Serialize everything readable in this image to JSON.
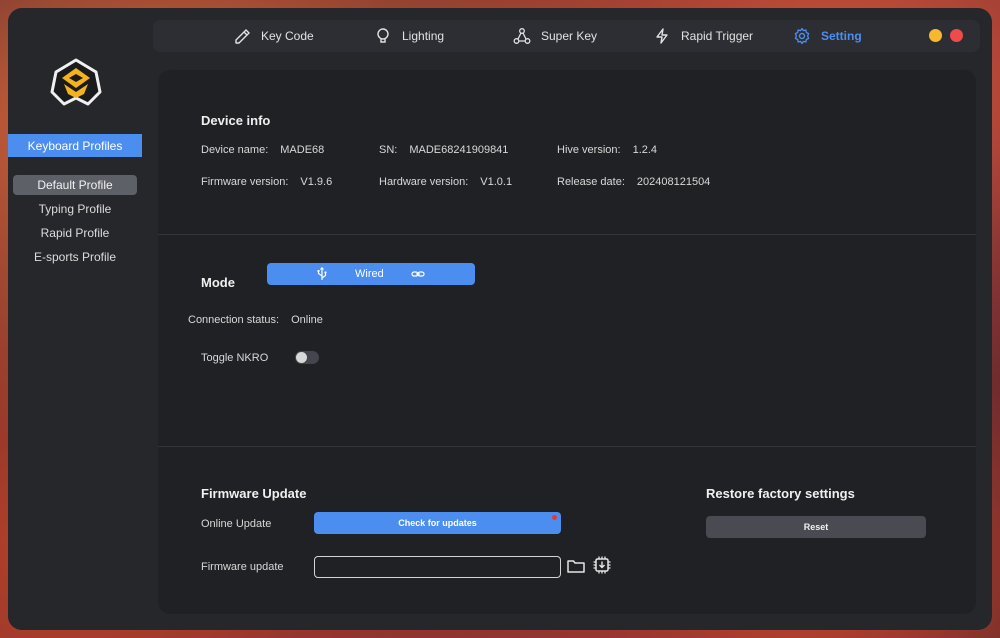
{
  "sidebar": {
    "header": "Keyboard Profiles",
    "profiles": [
      "Default Profile",
      "Typing Profile",
      "Rapid Profile",
      "E-sports Profile"
    ],
    "active_index": 0
  },
  "nav": {
    "items": [
      {
        "label": "Key Code",
        "icon": "pen-icon"
      },
      {
        "label": "Lighting",
        "icon": "bulb-icon"
      },
      {
        "label": "Super Key",
        "icon": "hub-icon"
      },
      {
        "label": "Rapid Trigger",
        "icon": "bolt-icon"
      },
      {
        "label": "Setting",
        "icon": "gear-icon"
      }
    ],
    "active": "Setting"
  },
  "window_controls": {
    "minimize_color": "#f5b82e",
    "close_color": "#ef4b4b"
  },
  "device_info": {
    "title": "Device info",
    "device_name_label": "Device name:",
    "device_name": "MADE68",
    "sn_label": "SN:",
    "sn": "MADE68241909841",
    "hive_label": "Hive version:",
    "hive": "1.2.4",
    "firmware_label": "Firmware version:",
    "firmware": "V1.9.6",
    "hardware_label": "Hardware version:",
    "hardware": "V1.0.1",
    "release_label": "Release date:",
    "release": "202408121504"
  },
  "mode": {
    "title": "Mode",
    "value": "Wired",
    "connection_label": "Connection status:",
    "connection": "Online",
    "nkro_label": "Toggle NKRO",
    "nkro_on": false
  },
  "firmware_update": {
    "title": "Firmware Update",
    "online_label": "Online Update",
    "check_button": "Check for updates",
    "file_label": "Firmware update",
    "file_value": ""
  },
  "restore": {
    "title": "Restore factory settings",
    "reset_button": "Reset"
  },
  "colors": {
    "accent": "#4c8ef0",
    "panel": "#202124",
    "app_bg": "#26272b"
  }
}
